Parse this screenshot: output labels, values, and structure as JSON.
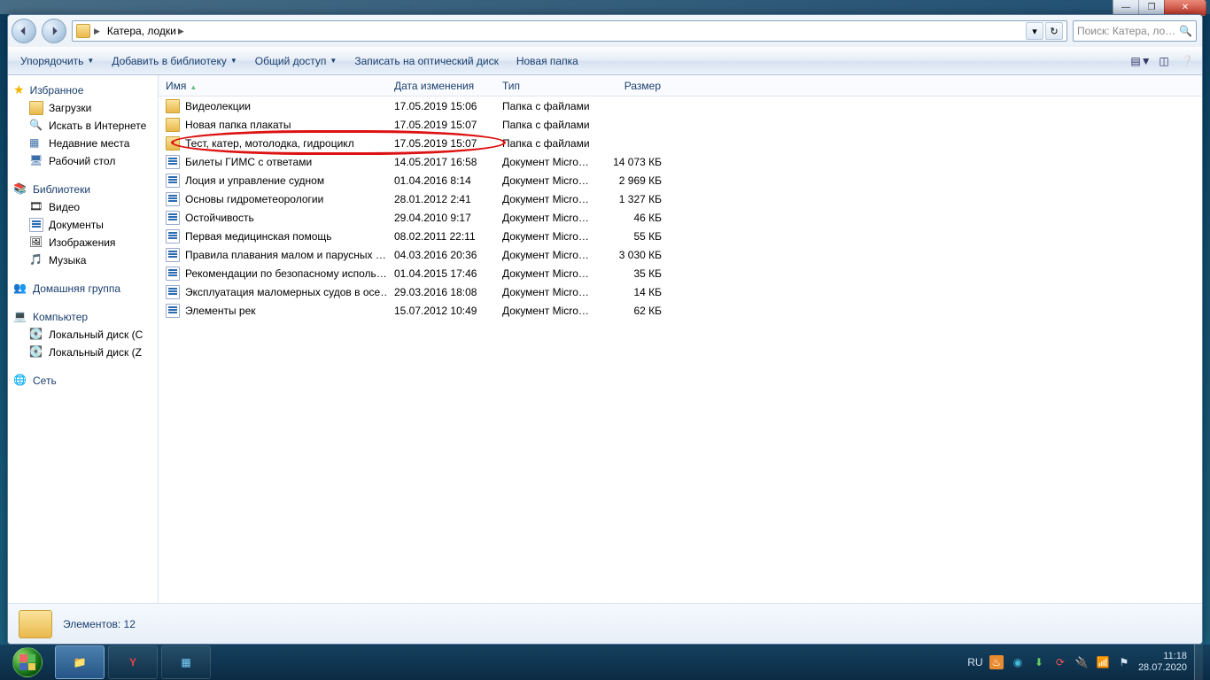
{
  "breadcrumb": {
    "location": "Катера, лодки"
  },
  "search": {
    "placeholder": "Поиск: Катера, ло…"
  },
  "cmdbar": {
    "organize": "Упорядочить",
    "addToLibrary": "Добавить в библиотеку",
    "share": "Общий доступ",
    "burn": "Записать на оптический диск",
    "newFolder": "Новая папка"
  },
  "sidebar": {
    "favorites": {
      "header": "Избранное",
      "items": [
        {
          "label": "Загрузки"
        },
        {
          "label": "Искать в Интернете"
        },
        {
          "label": "Недавние места"
        },
        {
          "label": "Рабочий стол"
        }
      ]
    },
    "libraries": {
      "header": "Библиотеки",
      "items": [
        {
          "label": "Видео"
        },
        {
          "label": "Документы"
        },
        {
          "label": "Изображения"
        },
        {
          "label": "Музыка"
        }
      ]
    },
    "homegroup": {
      "header": "Домашняя группа"
    },
    "computer": {
      "header": "Компьютер",
      "items": [
        {
          "label": "Локальный диск (C"
        },
        {
          "label": "Локальный диск (Z"
        }
      ]
    },
    "network": {
      "header": "Сеть"
    }
  },
  "columns": {
    "name": "Имя",
    "date": "Дата изменения",
    "type": "Тип",
    "size": "Размер"
  },
  "files": [
    {
      "icon": "folder",
      "name": "Видеолекции",
      "date": "17.05.2019 15:06",
      "type": "Папка с файлами",
      "size": ""
    },
    {
      "icon": "folder",
      "name": "Новая папка плакаты",
      "date": "17.05.2019 15:07",
      "type": "Папка с файлами",
      "size": ""
    },
    {
      "icon": "folder",
      "name": "Тест, катер, мотолодка, гидроцикл",
      "date": "17.05.2019 15:07",
      "type": "Папка с файлами",
      "size": ""
    },
    {
      "icon": "doc",
      "name": "Билеты ГИМС с ответами",
      "date": "14.05.2017 16:58",
      "type": "Документ Micros…",
      "size": "14 073 КБ"
    },
    {
      "icon": "doc",
      "name": "Лоция и управление судном",
      "date": "01.04.2016 8:14",
      "type": "Документ Micros…",
      "size": "2 969 КБ"
    },
    {
      "icon": "doc",
      "name": "Основы гидрометеорологии",
      "date": "28.01.2012 2:41",
      "type": "Документ Micros…",
      "size": "1 327 КБ"
    },
    {
      "icon": "doc",
      "name": "Остойчивость",
      "date": "29.04.2010 9:17",
      "type": "Документ Micros…",
      "size": "46 КБ"
    },
    {
      "icon": "doc",
      "name": "Первая медицинская помощь",
      "date": "08.02.2011 22:11",
      "type": "Документ Micros…",
      "size": "55 КБ"
    },
    {
      "icon": "doc",
      "name": "Правила плавания малом и парусных …",
      "date": "04.03.2016 20:36",
      "type": "Документ Micros…",
      "size": "3 030 КБ"
    },
    {
      "icon": "doc",
      "name": "Рекомендации по безопасному исполь…",
      "date": "01.04.2015 17:46",
      "type": "Документ Micros…",
      "size": "35 КБ"
    },
    {
      "icon": "doc",
      "name": "Эксплуатация маломерных судов в осе…",
      "date": "29.03.2016 18:08",
      "type": "Документ Micros…",
      "size": "14 КБ"
    },
    {
      "icon": "doc",
      "name": "Элементы рек",
      "date": "15.07.2012 10:49",
      "type": "Документ Micros…",
      "size": "62 КБ"
    }
  ],
  "details": {
    "count": "Элементов: 12"
  },
  "tray": {
    "lang": "RU",
    "time": "11:18",
    "date": "28.07.2020"
  }
}
